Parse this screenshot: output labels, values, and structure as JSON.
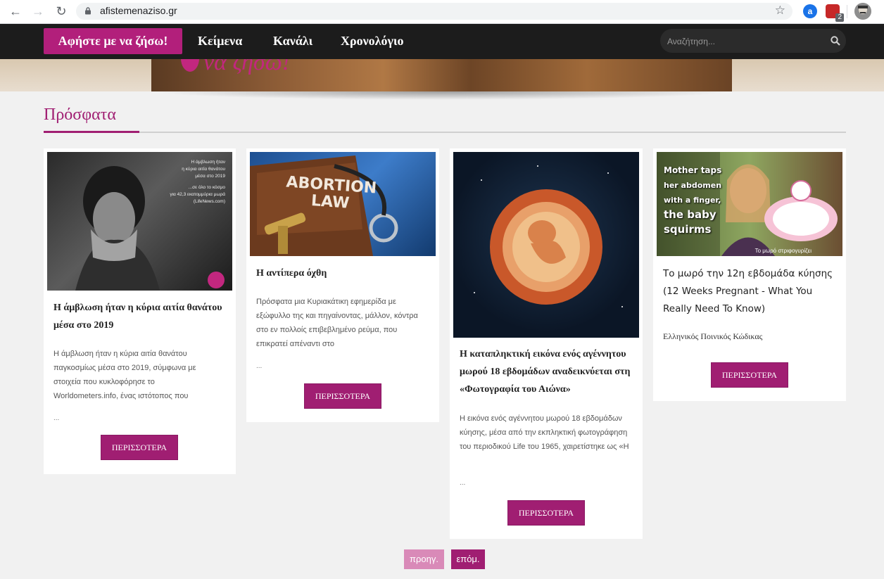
{
  "browser": {
    "url": "afistemenaziso.gr",
    "profile_badge": "2"
  },
  "site_nav": {
    "home_label": "Αφήστε με να ζήσω!",
    "menu": [
      "Κείμενα",
      "Κανάλι",
      "Χρονολόγιο"
    ],
    "search_placeholder": "Αναζήτηση..."
  },
  "hero": {
    "logo_text": "να ζήσω!"
  },
  "section": {
    "title": "Πρόσφατα"
  },
  "cards": [
    {
      "image_text": [
        "Η άμβλωση ήταν",
        "η κύρια αιτία θανάτου",
        "μέσα στο 2019",
        "...σε όλο το κόσμο",
        "για 42,3 εκατομμύρια μωρά",
        "(LifeNews.com)"
      ],
      "title": "Η άμβλωση ήταν η κύρια αιτία θανάτου μέσα στο 2019",
      "excerpt": "Η άμβλωση ήταν η κύρια αιτία θανάτου παγκοσμίως μέσα στο 2019, σύμφωνα με στοιχεία που κυκλοφόρησε το Worldometers.info, ένας ιστότοπος που",
      "dots": "...",
      "more": "ΠΕΡΙΣΣΟΤΕΡΑ"
    },
    {
      "image_text": [
        "ABORTION",
        "LAW"
      ],
      "title": "Η αντίπερα όχθη",
      "excerpt": "Πρόσφατα μια Κυριακάτικη εφημερίδα με εξώφυλλο της και πηγαίνοντας, μάλλον, κόντρα στο εν πολλοίς επιβεβλημένο ρεύμα, που επικρατεί απέναντι στο",
      "dots": "...",
      "more": "ΠΕΡΙΣΣΟΤΕΡΑ"
    },
    {
      "title": "Η καταπληκτική εικόνα ενός αγέννητου μωρού 18 εβδομάδων αναδεικνύεται στη «Φωτογραφία του Αιώνα»",
      "excerpt": "Η εικόνα ενός αγέννητου μωρού 18 εβδομάδων κύησης, μέσα  από την εκπληκτική φωτογράφηση του περιοδικού Life του 1965, χαιρετίστηκε ως «Η",
      "dots": "...",
      "more": "ΠΕΡΙΣΣΟΤΕΡΑ"
    },
    {
      "image_text": [
        "Mother taps",
        "her abdomen",
        "with a finger,",
        "the baby",
        "squirms",
        "Το μωρό στριφογυρίζει"
      ],
      "title": "Το μωρό την 12η εβδομάδα κύησης (12 Weeks Pregnant - What You Really Need To Know)",
      "category": "Ελληνικός Ποινικός Κώδικας",
      "more": "ΠΕΡΙΣΣΟΤΕΡΑ"
    }
  ],
  "pagination": {
    "prev": "προηγ.",
    "next": "επόμ."
  },
  "colors": {
    "accent": "#a01e72",
    "nav_bg": "#1c1c1c",
    "page_bg": "#f1f1f1"
  }
}
